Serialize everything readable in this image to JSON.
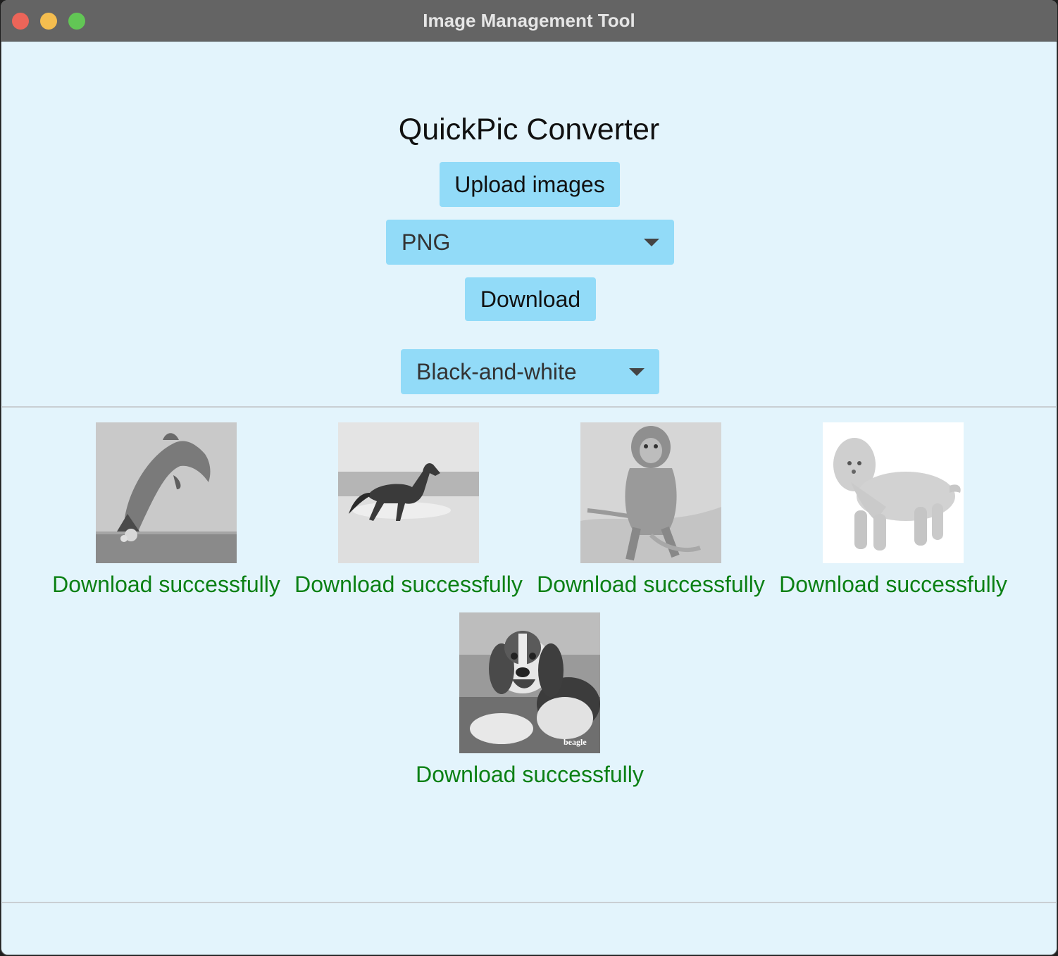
{
  "window": {
    "title": "Image Management Tool"
  },
  "app": {
    "title": "QuickPic Converter",
    "upload_label": "Upload images",
    "format_value": "PNG",
    "download_label": "Download",
    "filter_value": "Black-and-white"
  },
  "images": [
    {
      "subject": "dolphin",
      "status": "Download successfully"
    },
    {
      "subject": "horse",
      "status": "Download successfully"
    },
    {
      "subject": "monkey",
      "status": "Download successfully"
    },
    {
      "subject": "poodle",
      "status": "Download successfully"
    },
    {
      "subject": "beagle",
      "status": "Download successfully",
      "watermark": "beagle"
    }
  ],
  "colors": {
    "background": "#e3f4fc",
    "button": "#92dbf8",
    "success_text": "#0b8014",
    "titlebar": "#646464"
  }
}
